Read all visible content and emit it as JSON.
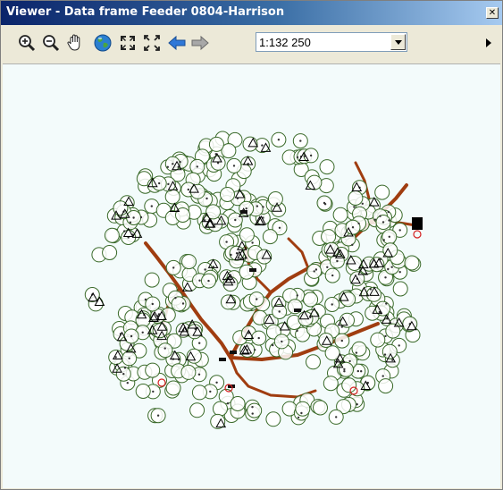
{
  "window": {
    "title": "Viewer - Data frame Feeder 0804-Harrison",
    "close_glyph": "✕"
  },
  "toolbar": {
    "tools": [
      {
        "name": "zoom-in-icon"
      },
      {
        "name": "zoom-out-icon"
      },
      {
        "name": "pan-hand-icon"
      },
      {
        "name": "full-extent-globe-icon"
      },
      {
        "name": "fixed-zoom-in-icon"
      },
      {
        "name": "fixed-zoom-out-icon"
      },
      {
        "name": "back-arrow-icon"
      },
      {
        "name": "forward-arrow-icon"
      }
    ],
    "scale": "1:132 250"
  },
  "colors": {
    "map_background": "#f3fbfb",
    "circle_stroke": "#3a6a2a",
    "line_color": "#a03d10",
    "triangle_stroke": "#000000",
    "marker_red": "#d42020"
  }
}
